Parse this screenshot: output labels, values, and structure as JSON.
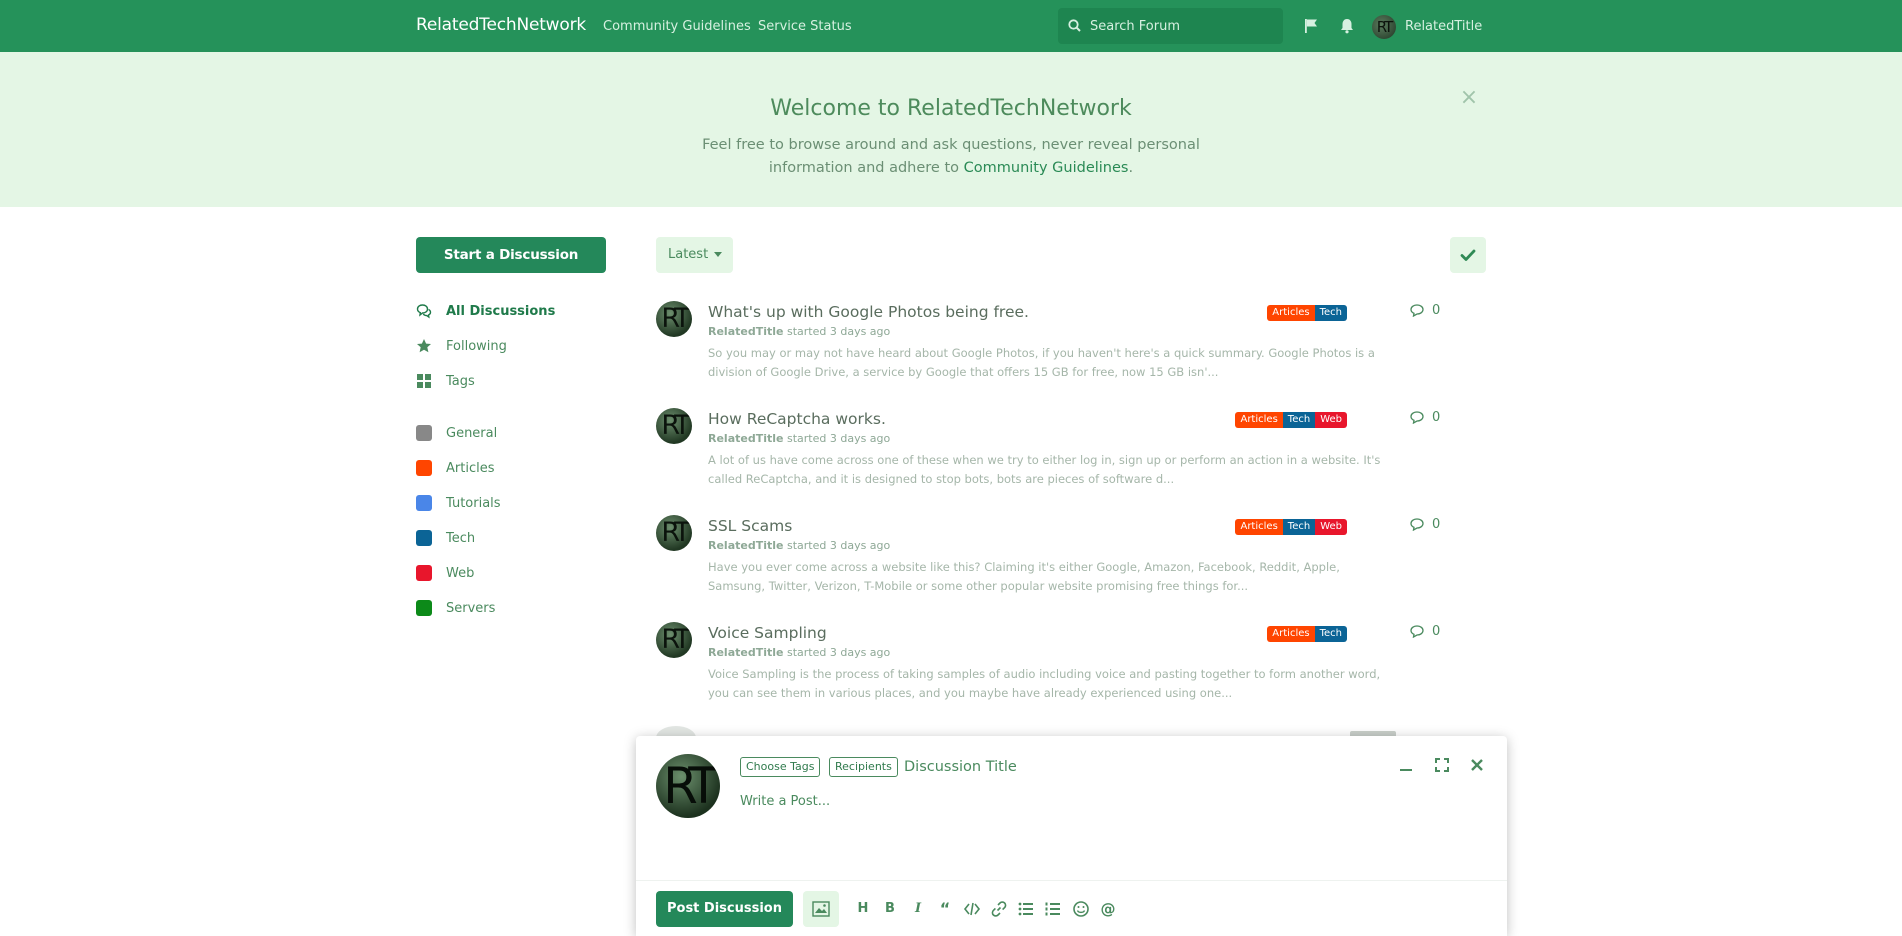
{
  "header": {
    "brand": "RelatedTechNetwork",
    "nav": [
      "Community Guidelines",
      "Service Status"
    ],
    "search_placeholder": "Search Forum",
    "username": "RelatedTitle",
    "avatar_initials": "RT"
  },
  "hero": {
    "title": "Welcome to RelatedTechNetwork",
    "text_before_link": "Feel free to browse around and ask questions, never reveal personal information and adhere to ",
    "link": "Community Guidelines",
    "text_after_link": ".",
    "close": "×"
  },
  "sidebar": {
    "start_button": "Start a Discussion",
    "nav": [
      {
        "label": "All Discussions",
        "icon": "comments-icon"
      },
      {
        "label": "Following",
        "icon": "star-icon"
      },
      {
        "label": "Tags",
        "icon": "grid-icon"
      }
    ],
    "tags": [
      {
        "label": "General",
        "color": "#888888"
      },
      {
        "label": "Articles",
        "color": "#ff4500"
      },
      {
        "label": "Tutorials",
        "color": "#4a86e8"
      },
      {
        "label": "Tech",
        "color": "#0b6496"
      },
      {
        "label": "Web",
        "color": "#e8162c"
      },
      {
        "label": "Servers",
        "color": "#0c8a19"
      }
    ]
  },
  "toolbar": {
    "sort_label": "Latest"
  },
  "tag_colors": {
    "Articles": "#ff4500",
    "Tech": "#0b6496",
    "Web": "#e8162c"
  },
  "discussions": [
    {
      "title": "What's up with Google Photos being free.",
      "author": "RelatedTitle",
      "started": "started 3 days ago",
      "excerpt": "So you may or may not have heard about Google Photos, if you haven't here's a quick summary. Google Photos is a division of Google Drive, a service by Google that offers 15 GB for free, now 15 GB isn'...",
      "tags": [
        "Articles",
        "Tech"
      ],
      "replies": "0"
    },
    {
      "title": "How ReCaptcha works.",
      "author": "RelatedTitle",
      "started": "started 3 days ago",
      "excerpt": "A lot of us have come across one of these when we try to either log in, sign up or perform an action in a website. It's called ReCaptcha, and it is designed to stop bots, bots are pieces of software d...",
      "tags": [
        "Articles",
        "Tech",
        "Web"
      ],
      "replies": "0"
    },
    {
      "title": "SSL Scams",
      "author": "RelatedTitle",
      "started": "started 3 days ago",
      "excerpt": "Have you ever come across a website like this? Claiming it's either Google, Amazon, Facebook, Reddit, Apple, Samsung, Twitter, Verizon, T-Mobile or some other popular website promising free things for...",
      "tags": [
        "Articles",
        "Tech",
        "Web"
      ],
      "replies": "0"
    },
    {
      "title": "Voice Sampling",
      "author": "RelatedTitle",
      "started": "started 3 days ago",
      "excerpt": "Voice Sampling is the process of taking samples of audio including voice and pasting together to form another word, you can see them in various places, and you maybe have already experienced using one...",
      "tags": [
        "Articles",
        "Tech"
      ],
      "replies": "0"
    }
  ],
  "composer": {
    "avatar_initials": "RT",
    "choose_tags": "Choose Tags",
    "recipients": "Recipients",
    "title_placeholder": "Discussion Title",
    "body_placeholder": "Write a Post...",
    "post_button": "Post Discussion",
    "format_tools": [
      "heading-icon",
      "bold-icon",
      "italic-icon",
      "quote-icon",
      "code-icon",
      "link-icon",
      "bullet-list-icon",
      "numbered-list-icon",
      "emoji-icon",
      "mention-icon"
    ]
  }
}
